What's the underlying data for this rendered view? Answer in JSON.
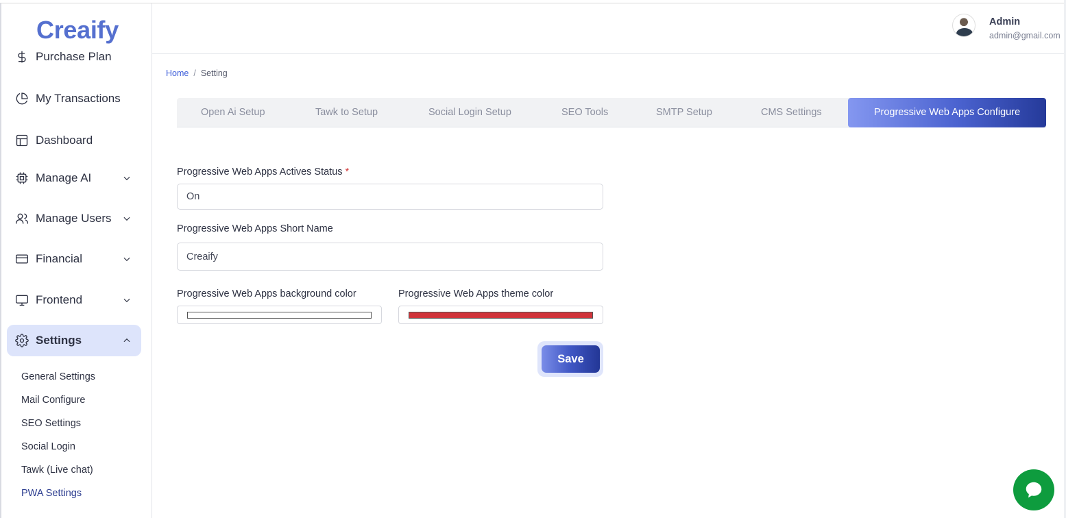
{
  "app": {
    "logo": "Creaify"
  },
  "sidebar": {
    "items": [
      {
        "label": "Purchase Plan",
        "icon": "dollar-icon"
      },
      {
        "label": "My Transactions",
        "icon": "pie-chart-icon"
      },
      {
        "label": "Dashboard",
        "icon": "layout-icon"
      },
      {
        "label": "Manage AI",
        "icon": "cpu-icon"
      },
      {
        "label": "Manage Users",
        "icon": "users-icon"
      },
      {
        "label": "Financial",
        "icon": "credit-card-icon"
      },
      {
        "label": "Frontend",
        "icon": "monitor-icon"
      },
      {
        "label": "Settings",
        "icon": "gear-icon"
      }
    ],
    "sub_items": [
      "General Settings",
      "Mail Configure",
      "SEO Settings",
      "Social Login",
      "Tawk (Live chat)",
      "PWA Settings"
    ]
  },
  "header": {
    "user_name": "Admin",
    "user_email": "admin@gmail.com"
  },
  "breadcrumb": {
    "home": "Home",
    "separator": "/",
    "current": "Setting"
  },
  "tabs": [
    "Open Ai Setup",
    "Tawk to Setup",
    "Social Login Setup",
    "SEO Tools",
    "SMTP Setup",
    "CMS Settings",
    "Progressive Web Apps Configure"
  ],
  "form": {
    "status_label": "Progressive Web Apps Actives Status",
    "required_mark": "*",
    "status_value": "On",
    "short_name_label": "Progressive Web Apps Short Name",
    "short_name_value": "Creaify",
    "bg_color_label": "Progressive Web Apps background color",
    "bg_color_value": "#ffffff",
    "theme_color_label": "Progressive Web Apps theme color",
    "theme_color_value": "#d0343a",
    "save_label": "Save"
  },
  "colors": {
    "accent": "#4b63d0",
    "brand": "#5570cf",
    "chat": "#0e9c3e"
  }
}
